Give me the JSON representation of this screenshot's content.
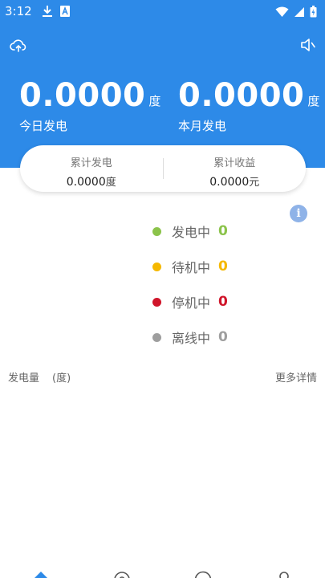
{
  "status_bar": {
    "time": "3:12",
    "icons": [
      "download-icon",
      "a-icon",
      "wifi-icon",
      "signal-icon",
      "battery-icon"
    ]
  },
  "header": {
    "bg_color": "#2d8ae8",
    "today": {
      "value": "0.0000",
      "unit": "度",
      "label": "今日发电"
    },
    "month": {
      "value": "0.0000",
      "unit": "度",
      "label": "本月发电"
    }
  },
  "summary": {
    "total_generation": {
      "title": "累计发电",
      "value": "0.0000",
      "unit": "度"
    },
    "total_income": {
      "title": "累计收益",
      "value": "0.0000",
      "unit": "元"
    }
  },
  "info_icon": "i",
  "legend": [
    {
      "label": "发电中",
      "count": "0",
      "color": "#8bc34a"
    },
    {
      "label": "待机中",
      "count": "0",
      "color": "#f5b800"
    },
    {
      "label": "停机中",
      "count": "0",
      "color": "#d0152a"
    },
    {
      "label": "离线中",
      "count": "0",
      "color": "#9e9e9e"
    }
  ],
  "chart_section": {
    "title": "发电量",
    "unit": "(度)",
    "more": "更多详情"
  },
  "bottom_nav": [
    "home-icon",
    "station-icon",
    "device-icon",
    "profile-icon"
  ]
}
